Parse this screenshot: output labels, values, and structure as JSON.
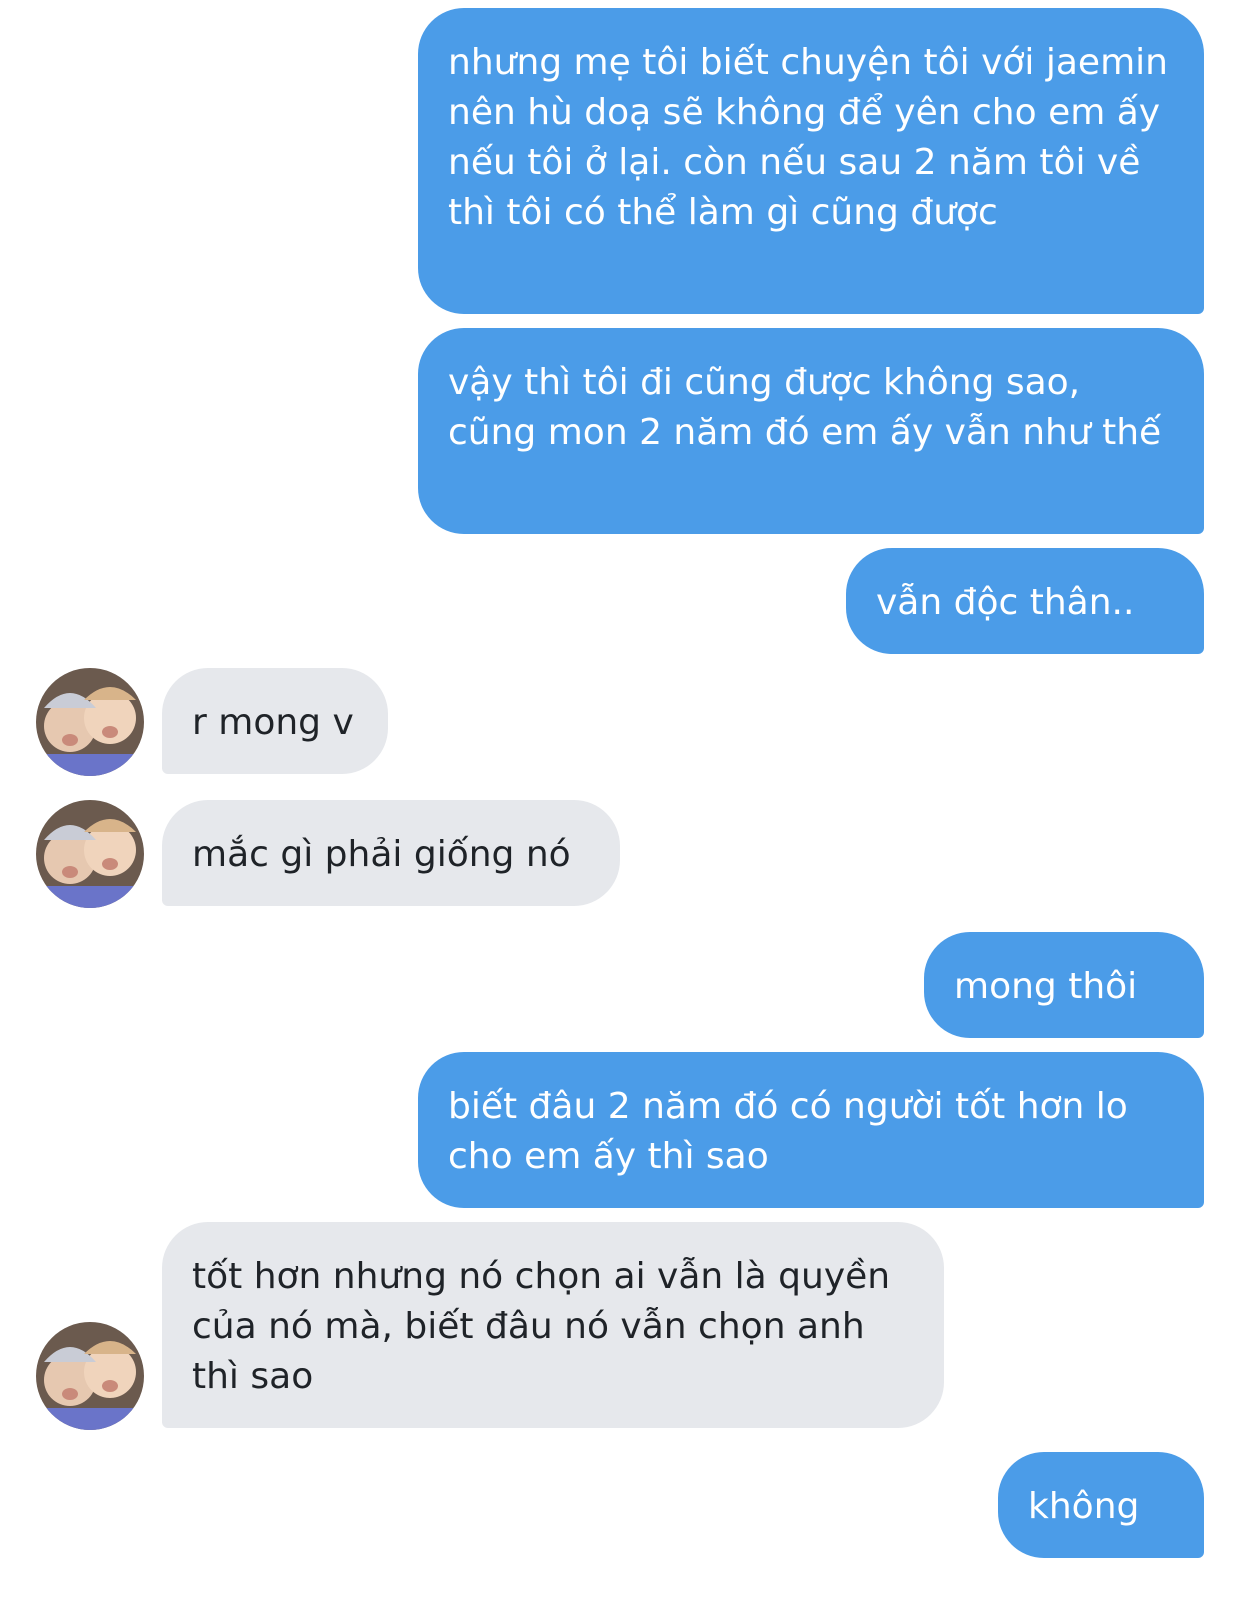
{
  "thread": {
    "messages": [
      {
        "side": "sent",
        "text": "nhưng mẹ tôi biết chuyện tôi với jaemin nên hù doạ sẽ không để yên cho em ấy nếu tôi ở lại. còn nếu sau 2 năm tôi về thì tôi có thể làm gì cũng được"
      },
      {
        "side": "sent",
        "text": "vậy thì tôi đi cũng được không sao, cũng mon 2 năm đó em ấy vẫn như thế"
      },
      {
        "side": "sent",
        "text": "vẫn độc thân.."
      },
      {
        "side": "received",
        "text": "r mong v"
      },
      {
        "side": "received",
        "text": "mắc gì phải giống nó"
      },
      {
        "side": "sent",
        "text": "mong thôi"
      },
      {
        "side": "sent",
        "text": "biết đâu 2 năm đó có người tốt hơn lo cho em ấy thì sao"
      },
      {
        "side": "received",
        "text": "tốt hơn nhưng nó chọn ai vẫn là quyền của nó mà, biết đâu nó vẫn chọn anh thì sao"
      },
      {
        "side": "sent",
        "text": "không"
      }
    ]
  },
  "colors": {
    "sent_bubble": "#4b9ce8",
    "received_bubble": "#e6e8ec",
    "sent_text": "#ffffff",
    "received_text": "#1f2328"
  },
  "icons": {
    "avatar": "contact-avatar-photo"
  }
}
